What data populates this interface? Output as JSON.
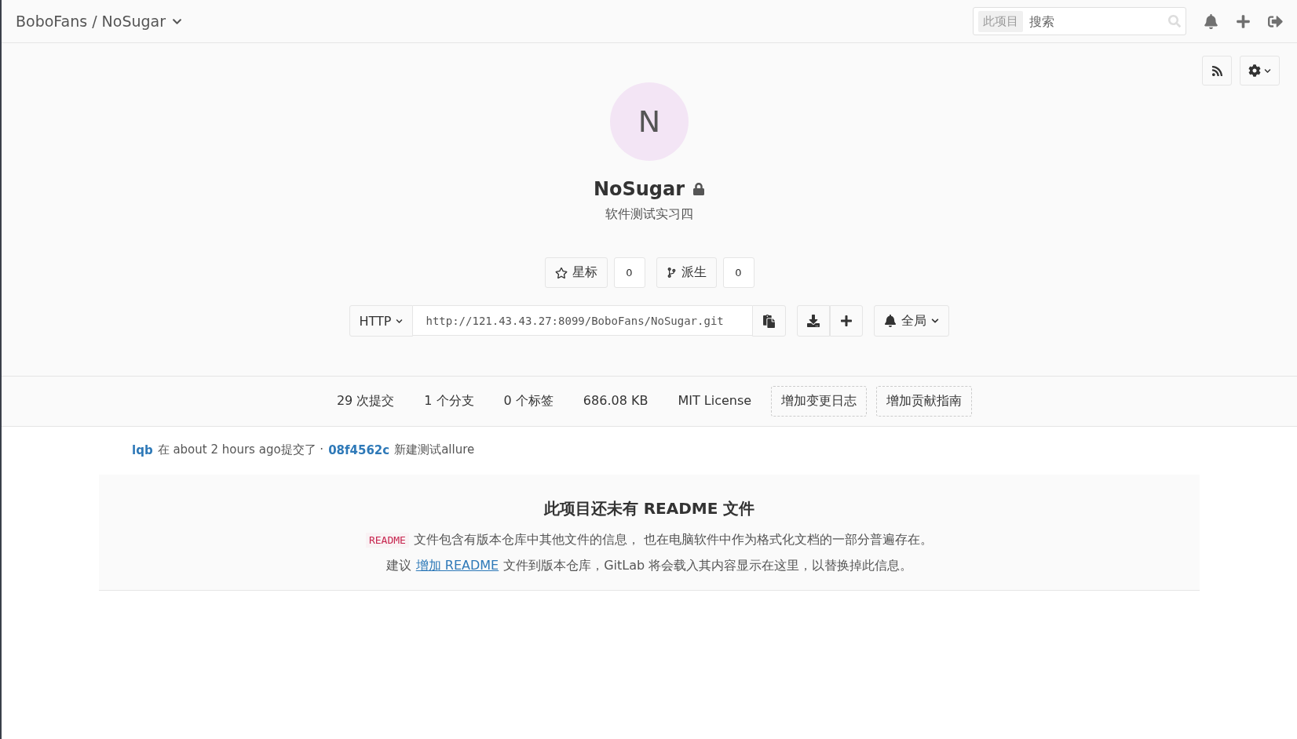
{
  "header": {
    "breadcrumb": "BoboFans / NoSugar",
    "search": {
      "scope": "此项目",
      "placeholder": "搜索"
    }
  },
  "project": {
    "avatar_letter": "N",
    "name": "NoSugar",
    "private": true,
    "description": "软件测试实习四",
    "star": {
      "label": "星标",
      "count": "0"
    },
    "fork": {
      "label": "派生",
      "count": "0"
    },
    "clone": {
      "protocol": "HTTP",
      "url": "http://121.43.43.27:8099/BoboFans/NoSugar.git"
    },
    "notification": "全局"
  },
  "stats": [
    {
      "kind": "stat",
      "label": "29 次提交"
    },
    {
      "kind": "stat",
      "label": "1 个分支"
    },
    {
      "kind": "stat",
      "label": "0 个标签"
    },
    {
      "kind": "stat",
      "label": "686.08 KB"
    },
    {
      "kind": "stat",
      "label": "MIT License"
    },
    {
      "kind": "add",
      "label": "增加变更日志"
    },
    {
      "kind": "add",
      "label": "增加贡献指南"
    }
  ],
  "last_commit": {
    "author": "lqb",
    "text": "在 about 2 hours ago提交了 ·",
    "sha": "08f4562c",
    "message": "新建测试allure"
  },
  "readme_notice": {
    "title": "此项目还未有 README 文件",
    "code": "README",
    "line1": "文件包含有版本仓库中其他文件的信息， 也在电脑软件中作为格式化文档的一部分普遍存在。",
    "line2_prefix": "建议",
    "link": "增加 README",
    "line2_suffix": "文件到版本仓库，GitLab 将会载入其内容显示在这里，以替换掉此信息。"
  }
}
